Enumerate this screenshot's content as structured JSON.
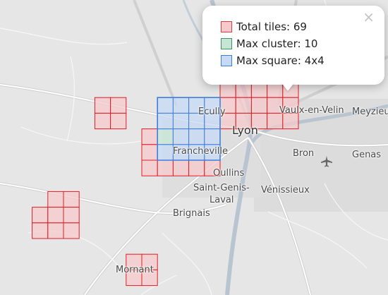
{
  "map": {
    "places": [
      {
        "id": "ecully",
        "name": "Ecully"
      },
      {
        "id": "lyon",
        "name": "Lyon"
      },
      {
        "id": "vaulx",
        "name": "Vaulx-en-Velin"
      },
      {
        "id": "meyzieu",
        "name": "Meyzieu"
      },
      {
        "id": "bron",
        "name": "Bron"
      },
      {
        "id": "genas",
        "name": "Genas"
      },
      {
        "id": "francheville",
        "name": "Francheville"
      },
      {
        "id": "oullins",
        "name": "Oullins"
      },
      {
        "id": "saint-genis",
        "name": "Saint-Genis-"
      },
      {
        "id": "laval",
        "name": "Laval"
      },
      {
        "id": "venissieux",
        "name": "Vénissieux"
      },
      {
        "id": "brignais",
        "name": "Brignais"
      },
      {
        "id": "mornant",
        "name": "Mornant"
      }
    ]
  },
  "popup": {
    "close_label": "×",
    "rows": [
      {
        "label": "Total tiles: 69",
        "fill": "#f7c9cb",
        "stroke": "#e03c41"
      },
      {
        "label": "Max cluster: 10",
        "fill": "#c7e5d5",
        "stroke": "#3d9468"
      },
      {
        "label": "Max square: 4x4",
        "fill": "#c6daf5",
        "stroke": "#3f7fdc"
      }
    ]
  },
  "colors": {
    "tile_fill": "#f7c9cb",
    "tile_stroke": "#dd1f26",
    "cluster_fill": "#c7e5d5",
    "square_fill": "#c6daf5",
    "square_stroke": "#3f7fdc",
    "water": "#bcc8d4",
    "road": "#ffffff",
    "major_road": "#d6d6d6"
  }
}
